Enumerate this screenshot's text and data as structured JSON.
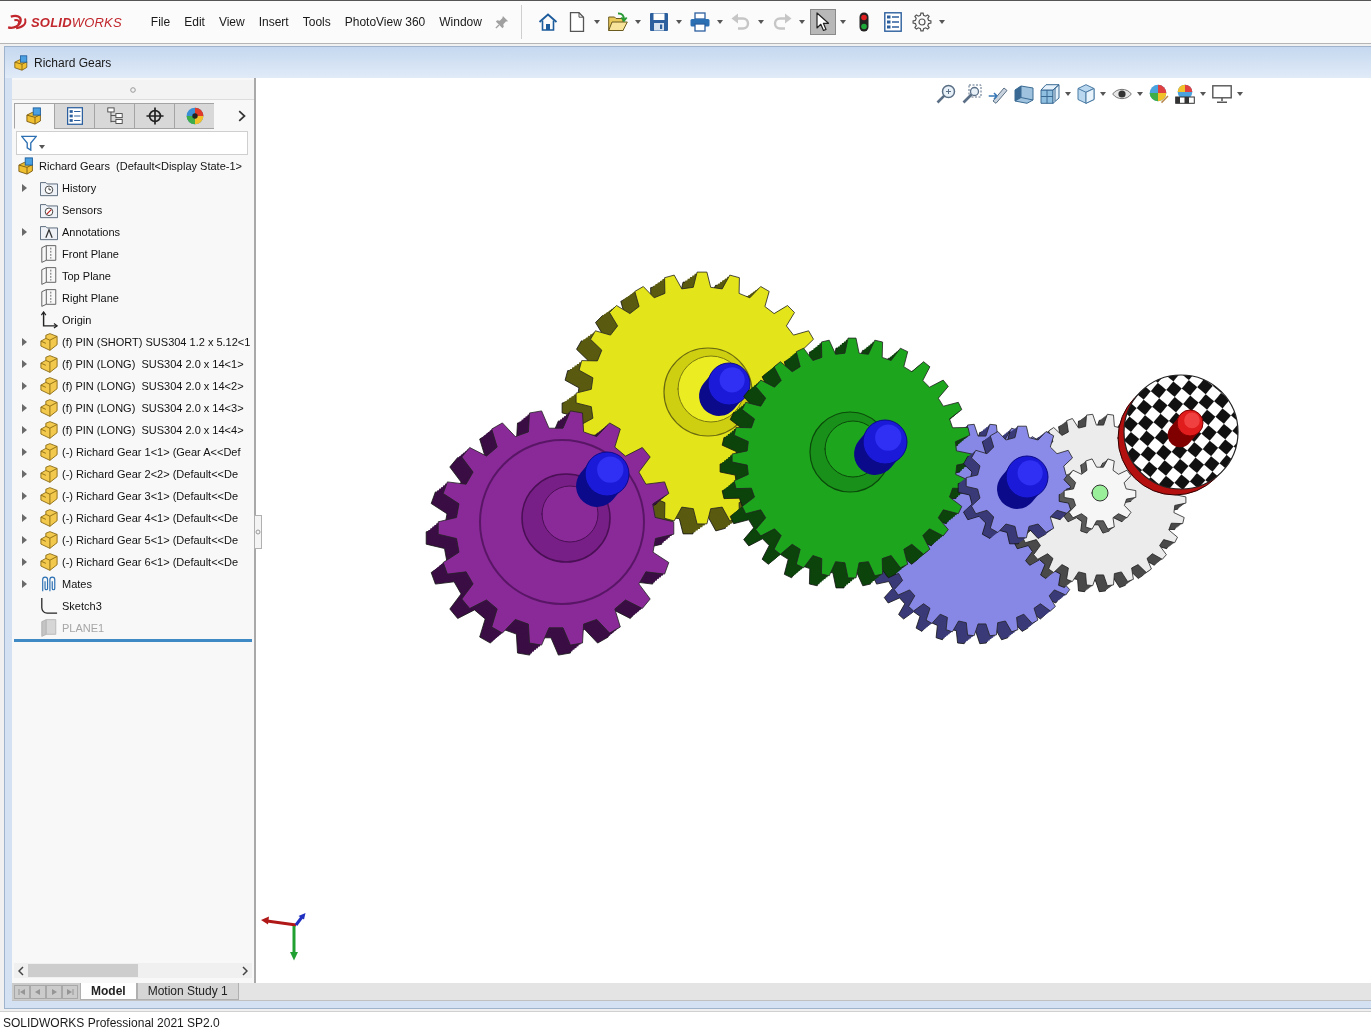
{
  "app_bar": {
    "logo": "**SOLID**WORKS",
    "menu": [
      "File",
      "Edit",
      "View",
      "Insert",
      "Tools",
      "PhotoView 360",
      "Window"
    ]
  },
  "toolbar": [
    {
      "kind": "home",
      "dropdown": false,
      "disabled": false,
      "selected": false
    },
    {
      "kind": "new",
      "dropdown": true,
      "disabled": false,
      "selected": false
    },
    {
      "kind": "open",
      "dropdown": true,
      "disabled": false,
      "selected": false
    },
    {
      "kind": "save",
      "dropdown": true,
      "disabled": false,
      "selected": false
    },
    {
      "kind": "print",
      "dropdown": true,
      "disabled": false,
      "selected": false
    },
    {
      "kind": "undo",
      "dropdown": true,
      "disabled": true,
      "selected": false
    },
    {
      "kind": "redo",
      "dropdown": true,
      "disabled": true,
      "selected": false
    },
    {
      "kind": "select",
      "dropdown": true,
      "disabled": false,
      "selected": true
    },
    {
      "kind": "rebuild",
      "dropdown": false,
      "disabled": false,
      "selected": false
    },
    {
      "kind": "properties",
      "dropdown": false,
      "disabled": false,
      "selected": false
    },
    {
      "kind": "options",
      "dropdown": true,
      "disabled": false,
      "selected": false
    }
  ],
  "document": {
    "title": "Richard Gears"
  },
  "feature_manager": {
    "tabs": [
      {
        "kind": "feature_tree",
        "selected": true
      },
      {
        "kind": "property_manager",
        "selected": false
      },
      {
        "kind": "configuration_manager",
        "selected": false
      },
      {
        "kind": "dimxpert",
        "selected": false
      },
      {
        "kind": "display_manager",
        "selected": false
      }
    ],
    "tree": [
      {
        "kind": "assembly",
        "label": "Richard Gears  (Default<Display State-1>",
        "expandable": false,
        "hidden": false,
        "children": [
          {
            "kind": "history",
            "label": "History",
            "expandable": true,
            "hidden": false
          },
          {
            "kind": "sensors",
            "label": "Sensors",
            "expandable": false,
            "hidden": false
          },
          {
            "kind": "annotations",
            "label": "Annotations",
            "expandable": true,
            "hidden": false
          },
          {
            "kind": "plane",
            "label": "Front Plane",
            "expandable": false,
            "hidden": false
          },
          {
            "kind": "plane",
            "label": "Top Plane",
            "expandable": false,
            "hidden": false
          },
          {
            "kind": "plane",
            "label": "Right Plane",
            "expandable": false,
            "hidden": false
          },
          {
            "kind": "origin",
            "label": "Origin",
            "expandable": false,
            "hidden": false
          },
          {
            "kind": "part",
            "label": "(f) PIN (SHORT) SUS304 1.2 x 5.12<1",
            "expandable": true,
            "hidden": false
          },
          {
            "kind": "part",
            "label": "(f) PIN (LONG)  SUS304 2.0 x 14<1>",
            "expandable": true,
            "hidden": false
          },
          {
            "kind": "part",
            "label": "(f) PIN (LONG)  SUS304 2.0 x 14<2>",
            "expandable": true,
            "hidden": false
          },
          {
            "kind": "part",
            "label": "(f) PIN (LONG)  SUS304 2.0 x 14<3>",
            "expandable": true,
            "hidden": false
          },
          {
            "kind": "part",
            "label": "(f) PIN (LONG)  SUS304 2.0 x 14<4>",
            "expandable": true,
            "hidden": false
          },
          {
            "kind": "part",
            "label": "(-) Richard Gear 1<1> (Gear A<<Def",
            "expandable": true,
            "hidden": false
          },
          {
            "kind": "part",
            "label": "(-) Richard Gear 2<2> (Default<<De",
            "expandable": true,
            "hidden": false
          },
          {
            "kind": "part",
            "label": "(-) Richard Gear 3<1> (Default<<De",
            "expandable": true,
            "hidden": false
          },
          {
            "kind": "part",
            "label": "(-) Richard Gear 4<1> (Default<<De",
            "expandable": true,
            "hidden": false
          },
          {
            "kind": "part",
            "label": "(-) Richard Gear 5<1> (Default<<De",
            "expandable": true,
            "hidden": false
          },
          {
            "kind": "part",
            "label": "(-) Richard Gear 6<1> (Default<<De",
            "expandable": true,
            "hidden": false
          },
          {
            "kind": "mates",
            "label": "Mates",
            "expandable": true,
            "hidden": false
          },
          {
            "kind": "sketch",
            "label": "Sketch3",
            "expandable": false,
            "hidden": false
          },
          {
            "kind": "plane",
            "label": "PLANE1",
            "expandable": false,
            "hidden": true
          }
        ]
      }
    ]
  },
  "view_toolbar": [
    {
      "kind": "zoom_fit",
      "dropdown": false
    },
    {
      "kind": "zoom_area",
      "dropdown": false
    },
    {
      "kind": "previous_view",
      "dropdown": false
    },
    {
      "kind": "section_view",
      "dropdown": false
    },
    {
      "kind": "view_orientation",
      "dropdown": true
    },
    {
      "kind": "display_style",
      "dropdown": true
    },
    {
      "kind": "hide_show",
      "dropdown": true
    },
    {
      "kind": "appearance",
      "dropdown": false
    },
    {
      "kind": "scene",
      "dropdown": true
    },
    {
      "kind": "view_settings",
      "dropdown": true
    }
  ],
  "bottom_tabs": [
    {
      "label": "Model",
      "selected": true
    },
    {
      "label": "Motion Study 1",
      "selected": false
    }
  ],
  "status_bar": {
    "text": "SOLIDWORKS Professional 2021 SP2.0"
  }
}
